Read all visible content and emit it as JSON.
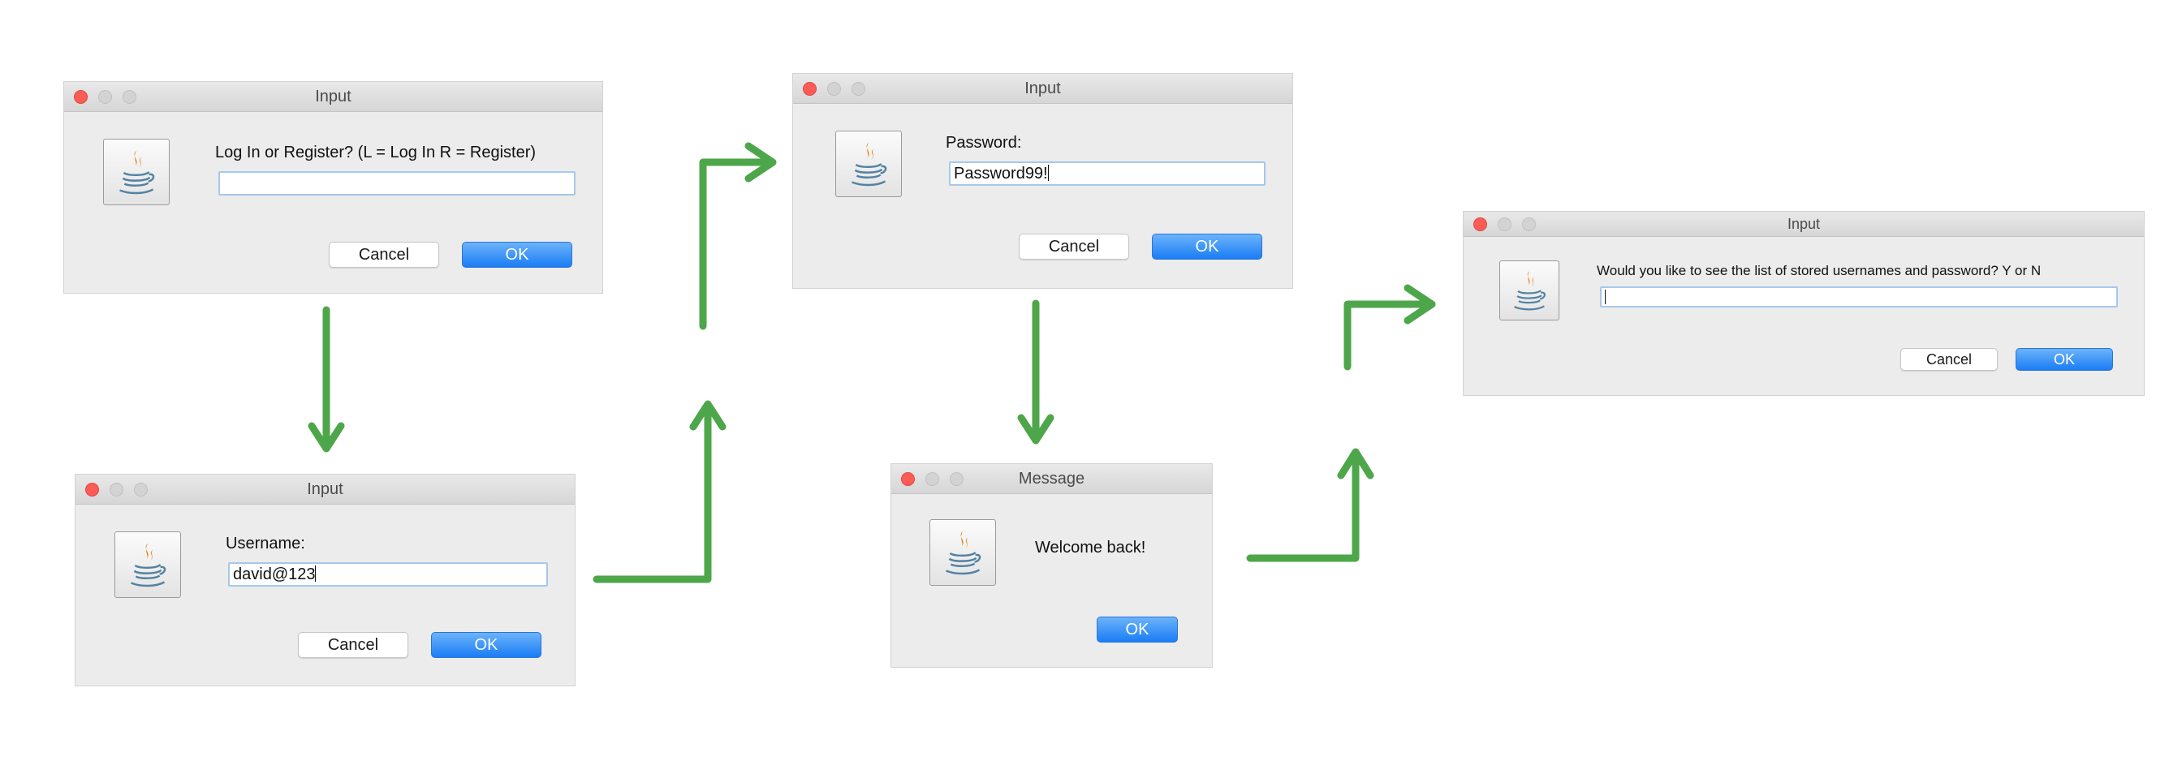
{
  "colors": {
    "arrow": "#4ea64a",
    "ok_button": "#1a7df5",
    "close_light": "#fc5c56",
    "dialog_bg": "#ececec"
  },
  "icons": [
    "java-cup-icon",
    "green-flow-arrow"
  ],
  "dialogs": {
    "login_choice": {
      "title": "Input",
      "prompt": "Log In or Register? (L = Log In  R = Register)",
      "field_value": "",
      "cancel_label": "Cancel",
      "ok_label": "OK"
    },
    "username": {
      "title": "Input",
      "prompt": "Username:",
      "field_value": "david@123",
      "cancel_label": "Cancel",
      "ok_label": "OK"
    },
    "password": {
      "title": "Input",
      "prompt": "Password:",
      "field_value": "Password99!",
      "cancel_label": "Cancel",
      "ok_label": "OK"
    },
    "message": {
      "title": "Message",
      "text": "Welcome back!",
      "ok_label": "OK"
    },
    "show_list": {
      "title": "Input",
      "prompt": "Would you like to see the list of stored usernames and password? Y or N",
      "field_value": "",
      "cancel_label": "Cancel",
      "ok_label": "OK"
    }
  }
}
